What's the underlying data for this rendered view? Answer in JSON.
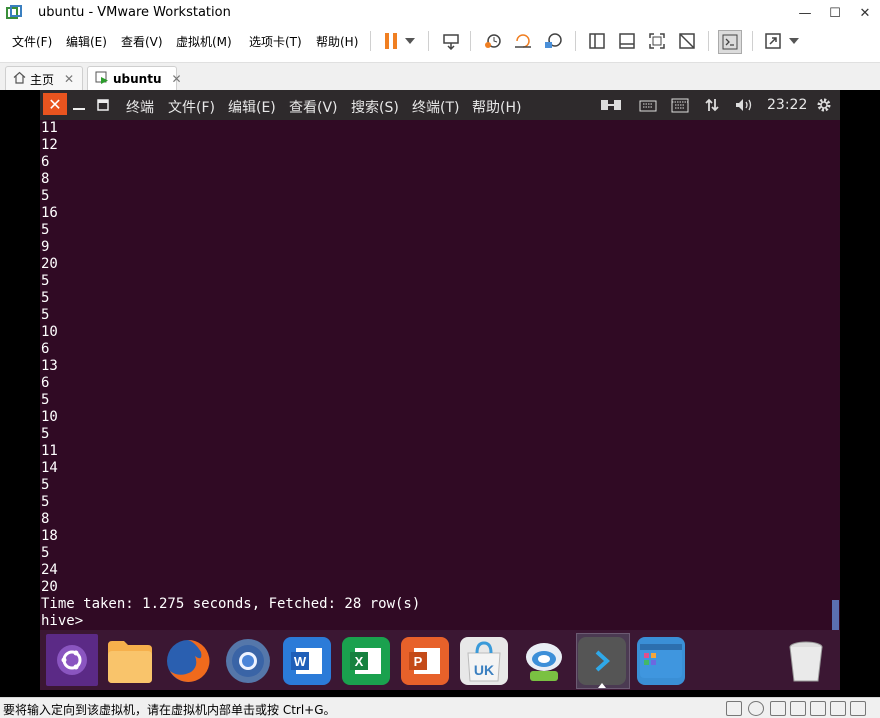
{
  "window": {
    "title": "ubuntu - VMware Workstation"
  },
  "menu": [
    "文件(F)",
    "编辑(E)",
    "查看(V)",
    "虚拟机(M)",
    "选项卡(T)",
    "帮助(H)"
  ],
  "tabs": [
    {
      "label": "主页"
    },
    {
      "label": "ubuntu"
    }
  ],
  "guest_panel": {
    "app_menus": [
      "终端",
      "文件(F)",
      "编辑(E)",
      "查看(V)",
      "搜索(S)",
      "终端(T)",
      "帮助(H)"
    ],
    "clock": "23:22"
  },
  "terminal": {
    "lines": [
      "11",
      "12",
      "6",
      "8",
      "5",
      "16",
      "5",
      "9",
      "20",
      "5",
      "5",
      "5",
      "10",
      "6",
      "13",
      "6",
      "5",
      "10",
      "5",
      "11",
      "14",
      "5",
      "5",
      "8",
      "18",
      "5",
      "24",
      "20",
      "Time taken: 1.275 seconds, Fetched: 28 row(s)",
      "hive>"
    ]
  },
  "dock": {
    "apps": [
      {
        "name": "ubuntu-launcher",
        "color": "#5b2a86"
      },
      {
        "name": "files",
        "color": "#f5a540"
      },
      {
        "name": "firefox",
        "color": "#e55b1c"
      },
      {
        "name": "chromium",
        "color": "#2f6fb8"
      },
      {
        "name": "wps-writer",
        "color": "#2b7bd8"
      },
      {
        "name": "wps-spreadsheets",
        "color": "#1aa14e"
      },
      {
        "name": "wps-presentation",
        "color": "#e7612a"
      },
      {
        "name": "ubuntu-kylin-software",
        "color": "#e8e8e8"
      },
      {
        "name": "system-tool",
        "color": "#4aa3dc"
      },
      {
        "name": "terminal",
        "color": "#4b4b4b"
      },
      {
        "name": "workspace-switcher",
        "color": "#3a8fd6"
      },
      {
        "name": "trash",
        "color": "#9a9a9a"
      }
    ]
  },
  "status": {
    "message": "要将输入定向到该虚拟机，请在虚拟机内部单击或按 Ctrl+G。"
  }
}
